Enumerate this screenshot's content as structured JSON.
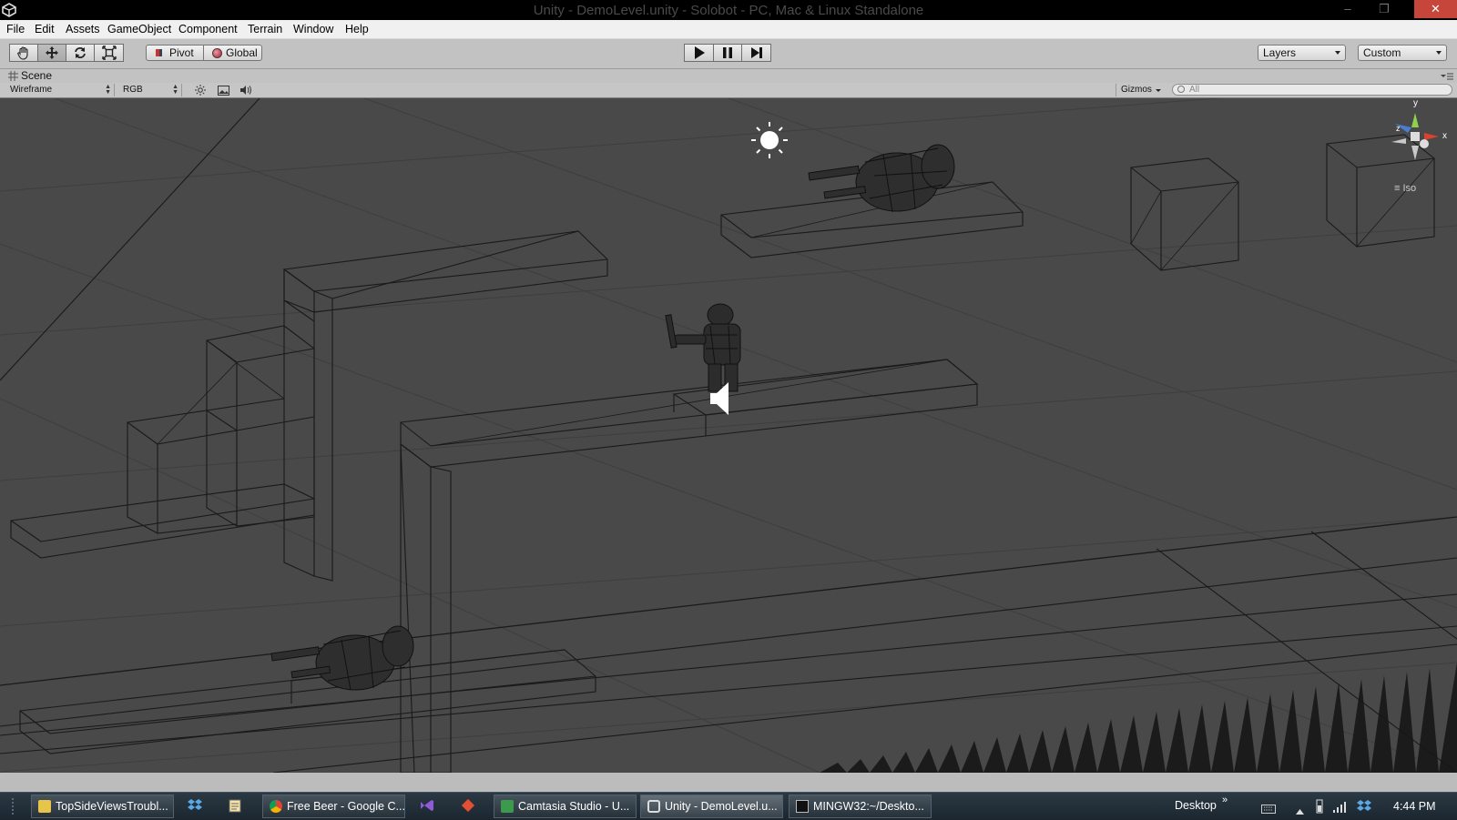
{
  "window": {
    "title": "Unity - DemoLevel.unity - Solobot - PC, Mac & Linux Standalone",
    "minimize": "–",
    "maximize": "❐",
    "close": "✕"
  },
  "menu": {
    "items": [
      "File",
      "Edit",
      "Assets",
      "GameObject",
      "Component",
      "Terrain",
      "Window",
      "Help"
    ]
  },
  "toolbar": {
    "pivot_label": "Pivot",
    "global_label": "Global",
    "layers_label": "Layers",
    "layout_label": "Custom",
    "tools": [
      "hand-icon",
      "move-icon",
      "rotate-icon",
      "scale-icon"
    ],
    "play_controls": [
      "play-icon",
      "pause-icon",
      "step-icon"
    ]
  },
  "scene": {
    "tab_label": "Scene",
    "render_mode": "Wireframe",
    "color_mode": "RGB",
    "gizmos_label": "Gizmos",
    "search_placeholder": "All",
    "gizmo_axis_y": "y",
    "gizmo_axis_x": "x",
    "gizmo_axis_z": "z",
    "projection_label": "Iso"
  },
  "taskbar": {
    "tasks": [
      "TopSideViewsTroubl...",
      "Free Beer - Google C...",
      "Camtasia Studio - U...",
      "Unity - DemoLevel.u...",
      "MINGW32:~/Deskto..."
    ],
    "desktop_label": "Desktop",
    "chevron": "»",
    "time": "4:44 PM"
  },
  "colors": {
    "viewport_bg": "#494949",
    "wire": "#161616",
    "toolbar_bg": "#c2c2c2",
    "taskbar_bg": "#1f2a33",
    "close_button": "#c7463c"
  }
}
